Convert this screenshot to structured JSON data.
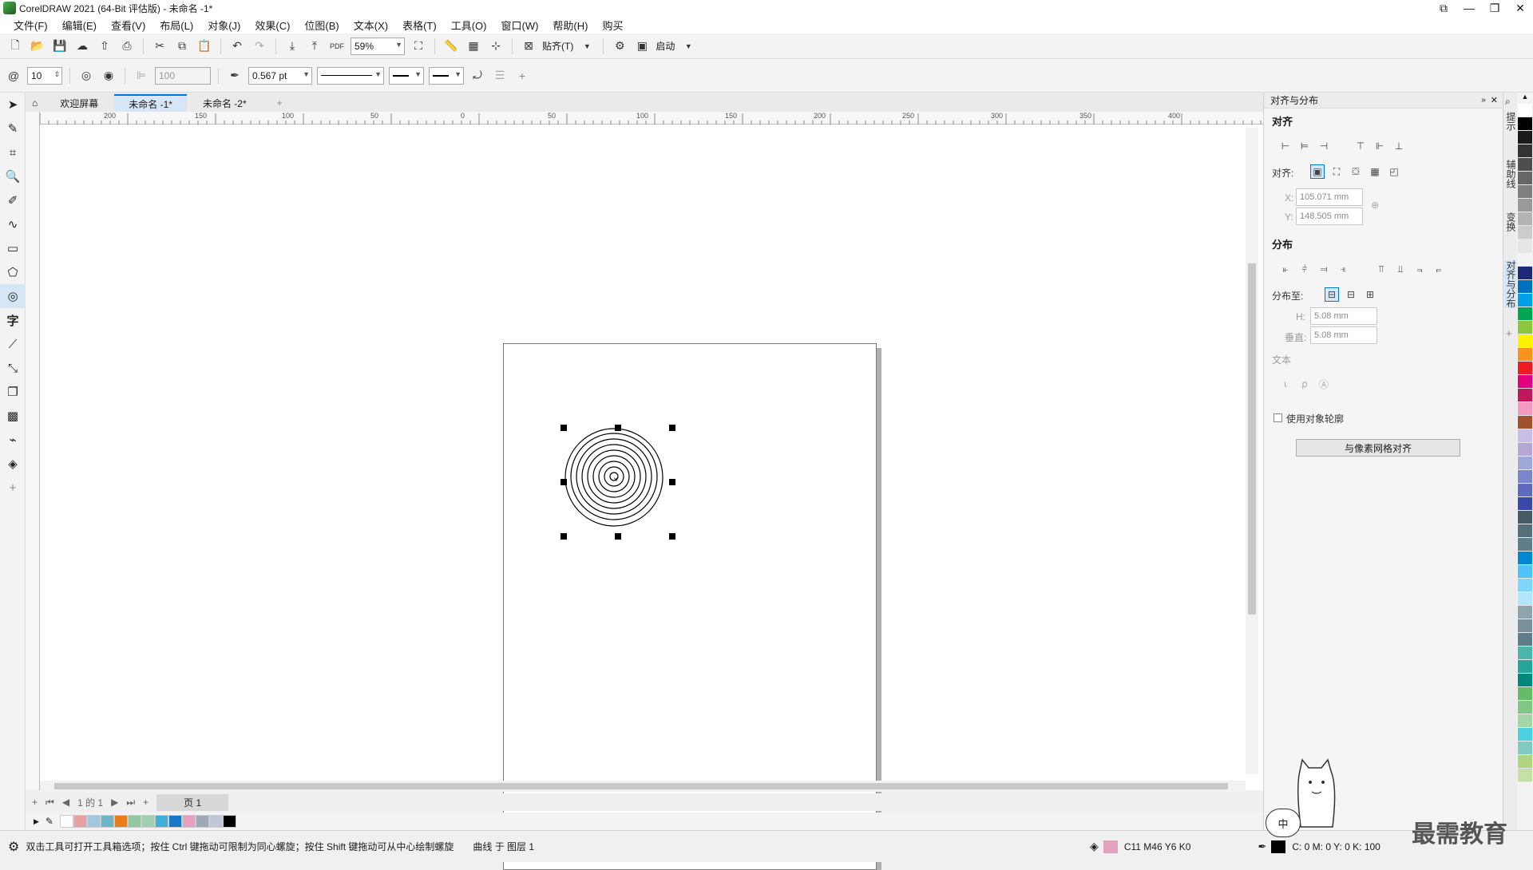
{
  "title_bar": {
    "title": "CorelDRAW 2021 (64-Bit 评估版) - 未命名 -1*",
    "controls": [
      "⧉",
      "—",
      "❐",
      "✕"
    ]
  },
  "menu": [
    "文件(F)",
    "编辑(E)",
    "查看(V)",
    "布局(L)",
    "对象(J)",
    "效果(C)",
    "位图(B)",
    "文本(X)",
    "表格(T)",
    "工具(O)",
    "窗口(W)",
    "帮助(H)",
    "购买"
  ],
  "toolbar1": {
    "zoom": "59%",
    "snap_label": "贴齐(T)",
    "launch_label": "启动"
  },
  "toolbar2": {
    "spiral_revolutions": "10",
    "disabled_value": "100",
    "outline_width": "0.567 pt"
  },
  "doc_tabs": [
    {
      "label": "欢迎屏幕",
      "active": false
    },
    {
      "label": "未命名 -1*",
      "active": true
    },
    {
      "label": "未命名 -2*",
      "active": false
    }
  ],
  "ruler_top": [
    "200",
    "150",
    "100",
    "50",
    "0",
    "50",
    "100",
    "150",
    "200",
    "250",
    "300",
    "350",
    "400"
  ],
  "page_nav": {
    "position": "1 的 1",
    "page_tab": "页 1"
  },
  "status": {
    "hint": "双击工具可打开工具箱选项；按住 Ctrl 键拖动可限制为同心螺旋；按住 Shift 键拖动可从中心绘制螺旋",
    "object_info": "曲线 于 图层 1",
    "fill_cmyk": "C11 M46 Y6 K0",
    "outline_cmyk": "C: 0 M: 0 Y: 0 K: 100",
    "fill_color": "#e3a3c0"
  },
  "docker": {
    "title": "对齐与分布",
    "align_section": "对齐",
    "align_to_label": "对齐:",
    "x_label": "X:",
    "x_value": "105.071 mm",
    "y_label": "Y:",
    "y_value": "148.505 mm",
    "distribute_section": "分布",
    "distribute_to_label": "分布至:",
    "h_label": "H:",
    "h_value": "5.08 mm",
    "v_label": "垂直:",
    "v_value": "5.08 mm",
    "text_section": "文本",
    "use_outline_label": "使用对象轮廓",
    "pixel_grid_button": "与像素网格对齐"
  },
  "docker_tabs": [
    "提示",
    "辅助线",
    "变换",
    "对齐与分布"
  ],
  "watermark": "最需教育",
  "ime_label": "中",
  "palette_colors": [
    "#ffffff",
    "#000000",
    "#1a1a1a",
    "#333333",
    "#4d4d4d",
    "#666666",
    "#808080",
    "#999999",
    "#b3b3b3",
    "#cccccc",
    "#e6e6e6",
    "#f2f2f2",
    "#1e2a78",
    "#0070c0",
    "#00a0e9",
    "#00a651",
    "#8dc63f",
    "#fff200",
    "#f7941d",
    "#ed1c24",
    "#e4007f",
    "#c2185b",
    "#f49ac1",
    "#a0522d",
    "#c8bfe7",
    "#b4a7d6",
    "#9fa8da",
    "#7986cb",
    "#5c6bc0",
    "#3949ab",
    "#455a64",
    "#546e7a",
    "#607d8b",
    "#0288d1",
    "#4fc3f7",
    "#81d4fa",
    "#b3e5fc",
    "#90a4ae",
    "#78909c",
    "#607d8b",
    "#4db6ac",
    "#26a69a",
    "#00897b",
    "#66bb6a",
    "#81c784",
    "#a5d6a7",
    "#4dd0e1",
    "#80cbc4",
    "#aed581",
    "#c5e1a5"
  ],
  "doc_palette": [
    "#ffffff",
    "#e8a0a0",
    "#a0c8e0",
    "#6cb4c8",
    "#e87d1e",
    "#90c8a0",
    "#a0d0b0",
    "#40b0d8",
    "#1878c8",
    "#e8a0c0",
    "#a0a8b8",
    "#c0c8d8",
    "#000000"
  ]
}
